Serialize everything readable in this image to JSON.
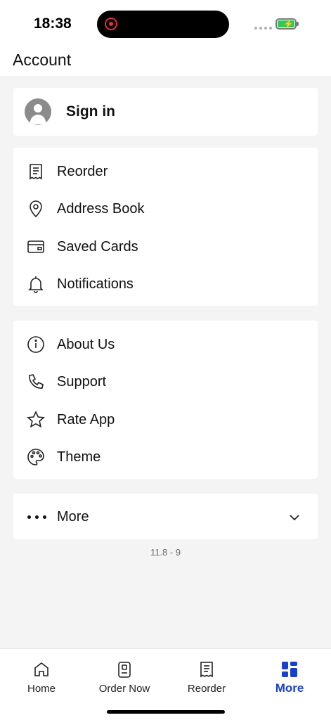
{
  "status_bar": {
    "time": "18:38"
  },
  "header": {
    "title": "Account"
  },
  "signin": {
    "label": "Sign in"
  },
  "account_menu": [
    {
      "label": "Reorder",
      "icon": "receipt-icon"
    },
    {
      "label": "Address Book",
      "icon": "location-pin-icon"
    },
    {
      "label": "Saved Cards",
      "icon": "credit-card-icon"
    },
    {
      "label": "Notifications",
      "icon": "bell-icon"
    }
  ],
  "info_menu": [
    {
      "label": "About Us",
      "icon": "info-icon"
    },
    {
      "label": "Support",
      "icon": "phone-icon"
    },
    {
      "label": "Rate App",
      "icon": "star-icon"
    },
    {
      "label": "Theme",
      "icon": "palette-icon"
    }
  ],
  "more": {
    "label": "More"
  },
  "version": "11.8 - 9",
  "tabbar": {
    "tabs": [
      {
        "label": "Home",
        "icon": "home-icon",
        "active": false
      },
      {
        "label": "Order Now",
        "icon": "order-icon",
        "active": false
      },
      {
        "label": "Reorder",
        "icon": "receipt-icon",
        "active": false
      },
      {
        "label": "More",
        "icon": "grid-icon",
        "active": true
      }
    ]
  },
  "colors": {
    "accent": "#1a3fcc",
    "background": "#f4f4f4",
    "card": "#ffffff",
    "recording": "#e0313a",
    "battery": "#34c759"
  }
}
